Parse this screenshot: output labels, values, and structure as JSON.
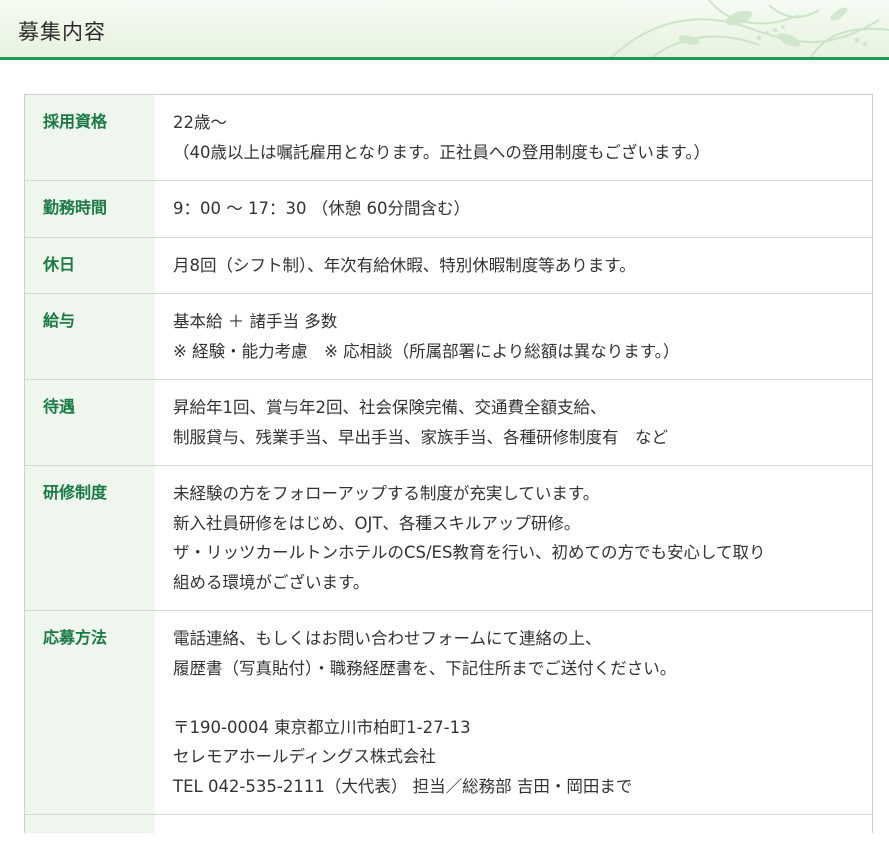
{
  "header": {
    "title": "募集内容"
  },
  "rows": [
    {
      "label": "採用資格",
      "lines": [
        "22歳～",
        "（40歳以上は嘱託雇用となります。正社員への登用制度もございます。）"
      ]
    },
    {
      "label": "勤務時間",
      "lines": [
        "9：00 ～ 17：30 （休憩 60分間含む）"
      ]
    },
    {
      "label": "休日",
      "lines": [
        "月8回（シフト制）、年次有給休暇、特別休暇制度等あります。"
      ]
    },
    {
      "label": "給与",
      "lines": [
        "基本給 ＋ 諸手当 多数",
        "※ 経験・能力考慮　※ 応相談（所属部署により総額は異なります。）"
      ]
    },
    {
      "label": "待遇",
      "lines": [
        "昇給年1回、賞与年2回、社会保険完備、交通費全額支給、",
        "制服貸与、残業手当、早出手当、家族手当、各種研修制度有　など"
      ]
    },
    {
      "label": "研修制度",
      "lines": [
        "未経験の方をフォローアップする制度が充実しています。",
        "新入社員研修をはじめ、OJT、各種スキルアップ研修。",
        "ザ・リッツカールトンホテルのCS/ES教育を行い、初めての方でも安心して取り",
        "組める環境がございます。"
      ]
    },
    {
      "label": "応募方法",
      "lines": [
        "電話連絡、もしくはお問い合わせフォームにて連絡の上、",
        "履歴書（写真貼付）・職務経歴書を、下記住所までご送付ください。",
        "",
        "〒190-0004 東京都立川市柏町1-27-13",
        "セレモアホールディングス株式会社",
        "TEL 042-535-2111（大代表） 担当／総務部 吉田・岡田まで"
      ]
    }
  ],
  "colors": {
    "accent": "#1e9a57",
    "label_text": "#1a7a44",
    "label_bg": "#eef6ed"
  }
}
